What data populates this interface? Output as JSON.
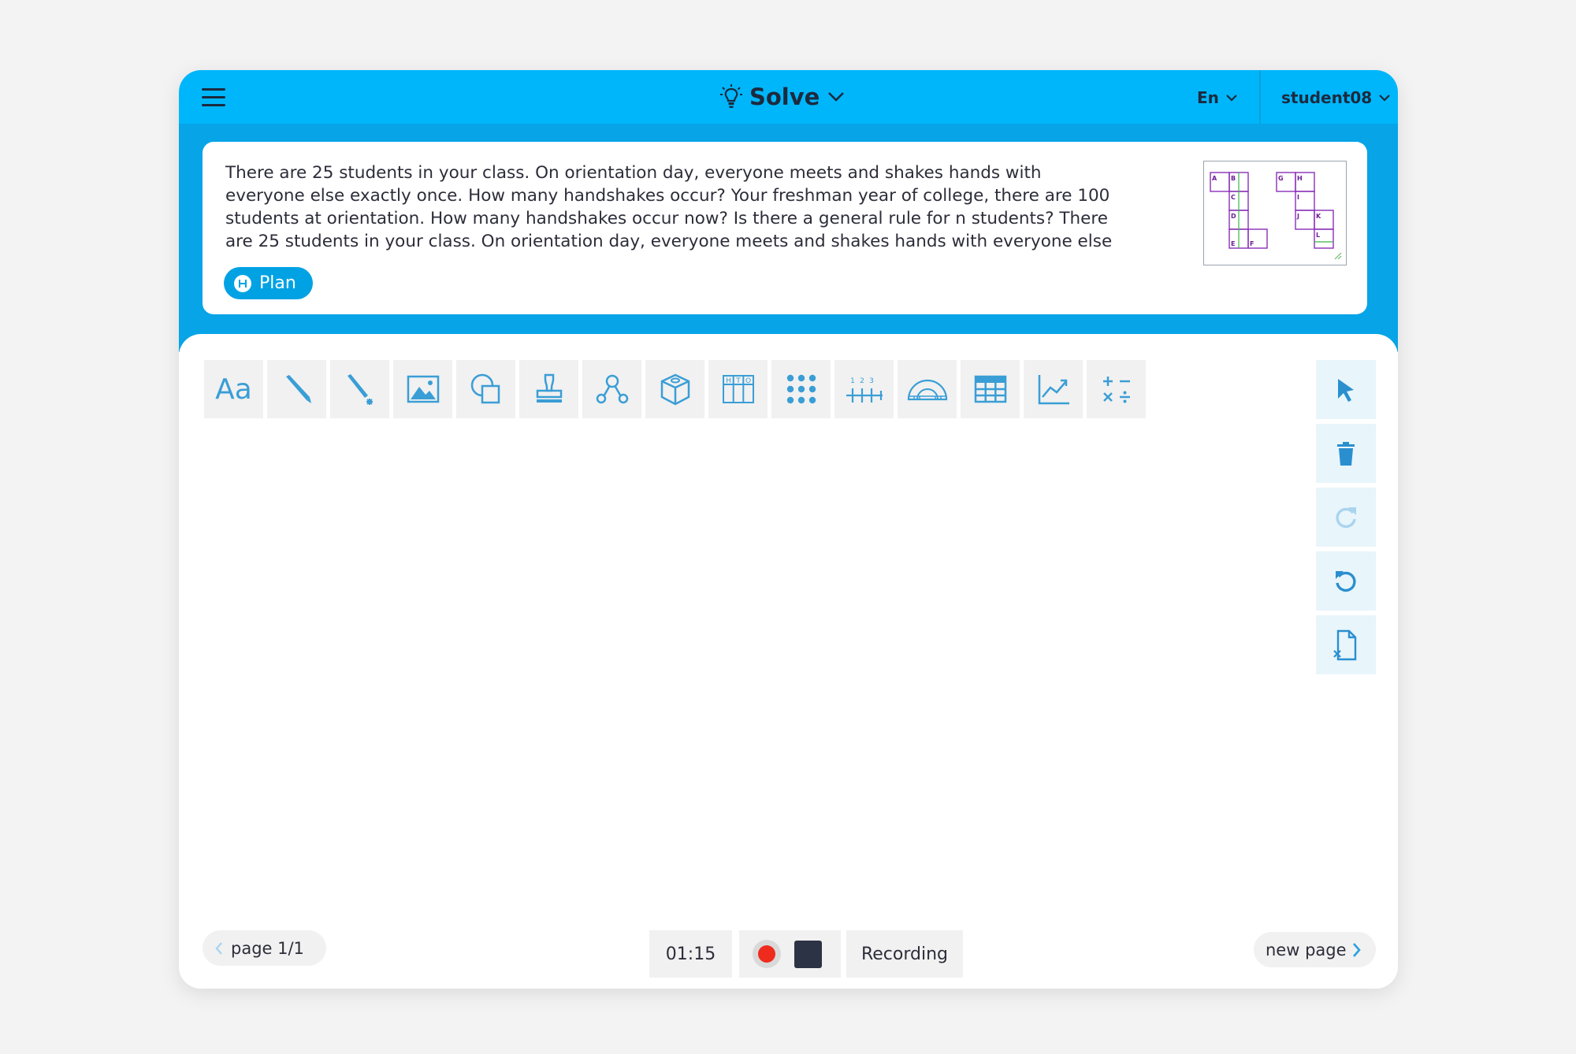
{
  "header": {
    "title": "Solve",
    "language": "En",
    "user": "student08"
  },
  "problem": {
    "lines": [
      "There are 25 students in your class. On orientation day, everyone meets and shakes hands with",
      "everyone else exactly once. How many handshakes occur? Your freshman year of college, there are 100",
      "students at orientation. How many handshakes occur now? Is there a general rule for n students? There",
      "are 25 students in your class. On orientation day, everyone meets and shakes hands with everyone else"
    ],
    "plan_label": "Plan",
    "thumbnail_labels": [
      "A",
      "B",
      "C",
      "D",
      "E",
      "F",
      "G",
      "H",
      "I",
      "J",
      "K",
      "L"
    ]
  },
  "toolbar": {
    "text_tool_label": "Aa",
    "ht_o_labels": [
      "H",
      "T",
      "O"
    ],
    "number_line_labels": [
      "1",
      "2",
      "3"
    ],
    "tools": [
      "text",
      "pen",
      "highlighter",
      "image",
      "shapes",
      "stamp",
      "network",
      "cube",
      "place-value",
      "dot-array",
      "number-line",
      "protractor",
      "table",
      "graph",
      "operations"
    ]
  },
  "footer": {
    "page_label": "page 1/1",
    "timer": "01:15",
    "recording_label": "Recording",
    "new_page_label": "new page"
  },
  "colors": {
    "header": "#00b6fb",
    "band": "#07a4e7",
    "tool_icon": "#3a9ed6",
    "record": "#ee2b1c"
  }
}
